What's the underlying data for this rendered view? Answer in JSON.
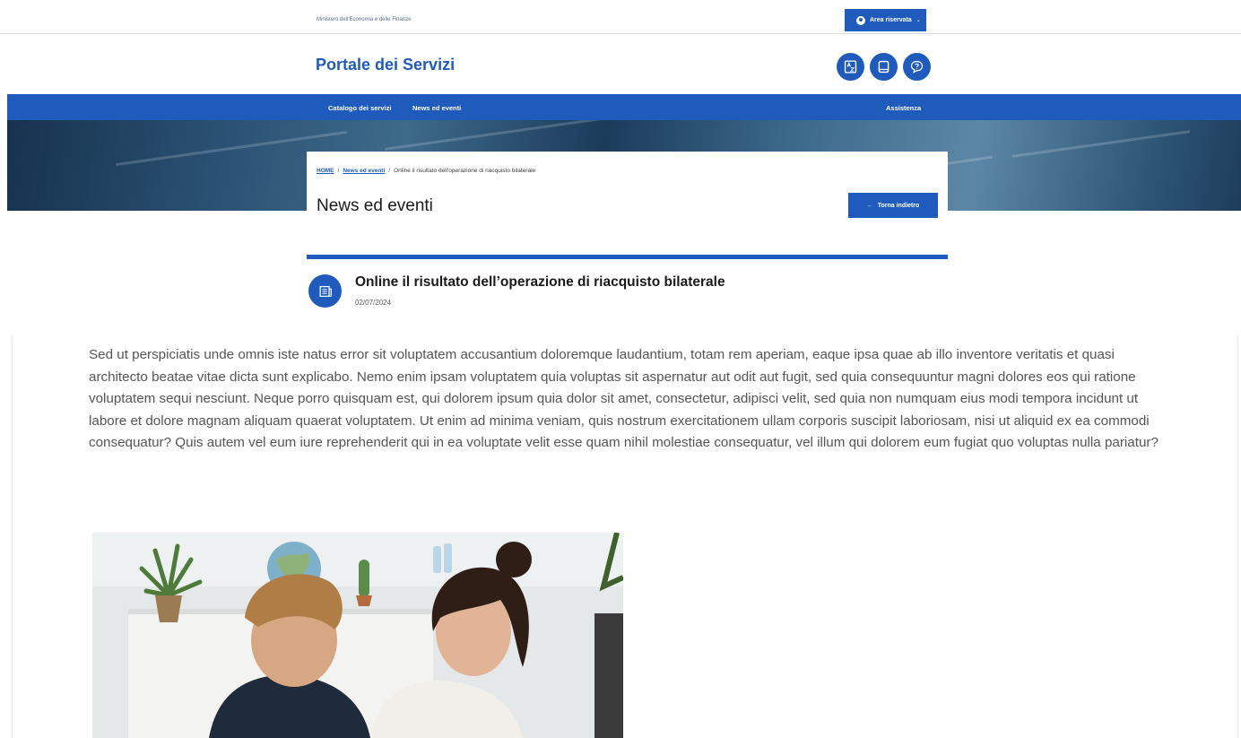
{
  "topbar": {
    "ministry": "Ministero dell'Economia e delle Finanze",
    "area_label": "Area riservata"
  },
  "header": {
    "brand": "Portale dei Servizi"
  },
  "nav": {
    "items": [
      "Catalogo dei servizi",
      "News ed eventi"
    ],
    "assist": "Assistenza"
  },
  "breadcrumb": {
    "home": "HOME",
    "section": "News ed eventi",
    "current": "Online il risultato dell'operazione di riacquisto bilaterale"
  },
  "page": {
    "title": "News ed eventi",
    "back_label": "Torna indietro"
  },
  "article": {
    "title": "Online il risultato dell’operazione di riacquisto bilaterale",
    "date": "02/07/2024",
    "body": "Sed ut perspiciatis unde omnis iste natus error sit voluptatem accusantium doloremque laudantium, totam rem aperiam, eaque ipsa quae ab illo inventore veritatis et quasi architecto beatae vitae dicta sunt explicabo. Nemo enim ipsam voluptatem quia voluptas sit aspernatur aut odit aut fugit, sed quia consequuntur magni dolores eos qui ratione voluptatem sequi nesciunt. Neque porro quisquam est, qui dolorem ipsum quia dolor sit amet, consectetur, adipisci velit, sed quia non numquam eius modi tempora incidunt ut labore et dolore magnam aliquam quaerat voluptatem. Ut enim ad minima veniam, quis nostrum exercitationem ullam corporis suscipit laboriosam, nisi ut aliquid ex ea commodi consequatur? Quis autem vel eum iure reprehenderit qui in ea voluptate velit esse quam nihil molestiae consequatur, vel illum qui dolorem eum fugiat quo voluptas nulla pariatur?"
  },
  "icons": {
    "user": "user-icon",
    "glossary": "a-z-glossary-icon",
    "manual": "book-icon",
    "faq": "help-chat-icon",
    "news": "newspaper-icon",
    "back": "arrow-left-icon"
  },
  "colors": {
    "primary": "#1f5bbd",
    "text": "#1a1a1a",
    "muted": "#555555"
  }
}
